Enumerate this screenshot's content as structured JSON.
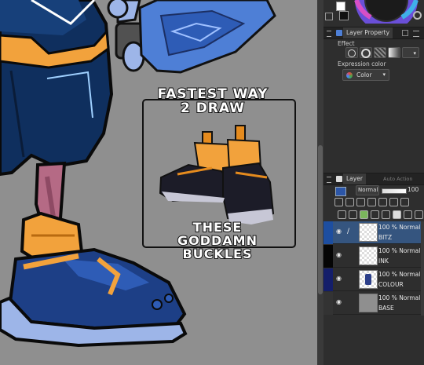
{
  "canvas": {
    "caption_top": [
      "FASTEST WAY",
      "2 DRAW"
    ],
    "caption_bottom": [
      "THESE",
      "GODDAMN",
      "BUCKLES"
    ]
  },
  "layer_property": {
    "tab_label": "Layer Property",
    "effect_label": "Effect",
    "expression_color_label": "Expression color",
    "expression_color_value": "Color"
  },
  "layer_panel": {
    "tabs": [
      "Layer",
      "Auto Action"
    ],
    "blend_mode": "Normal",
    "opacity": "100",
    "layers": [
      {
        "opacity_text": "100 % Normal",
        "name": "BITZ",
        "selected": true,
        "row_color": "#35557f",
        "thumb": "checker"
      },
      {
        "opacity_text": "100 % Normal",
        "name": "INK",
        "selected": false,
        "row_color": "#050505",
        "thumb": "checker"
      },
      {
        "opacity_text": "100 % Normal",
        "name": "COLOUR",
        "selected": false,
        "row_color": "#141e6a",
        "thumb": "checker"
      },
      {
        "opacity_text": "100 % Normal",
        "name": "BASE",
        "selected": false,
        "row_color": "#333333",
        "thumb": "gray"
      }
    ]
  },
  "colors": {
    "canvas_bg": "#8f8f8f",
    "accent_blue": "#3c6fd0",
    "selected_layer": "#35557f"
  }
}
